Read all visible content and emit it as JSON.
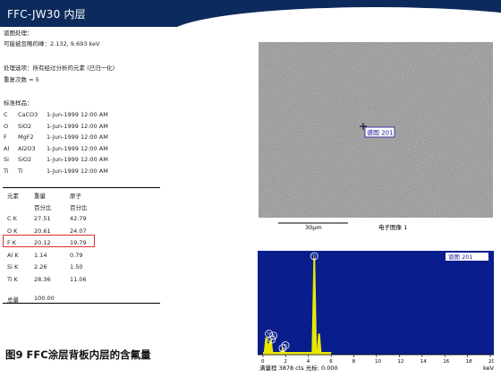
{
  "header": {
    "title": "FFC-JW30 内层"
  },
  "processing": {
    "label": "谱图处理：",
    "omitted_peaks": "可能被忽略的峰：2.132, 9.693 keV",
    "options": "处理选项：所有经过分析的元素 (已归一化)",
    "iterations": "重复次数 = 5"
  },
  "standards": {
    "label": "标准样品：",
    "rows": [
      {
        "el": "C",
        "std": "CaCO3",
        "date": "1-Jun-1999 12:00 AM"
      },
      {
        "el": "O",
        "std": "SiO2",
        "date": "1-Jun-1999 12:00 AM"
      },
      {
        "el": "F",
        "std": "MgF2",
        "date": "1-Jun-1999 12:00 AM"
      },
      {
        "el": "Al",
        "std": "Al2O3",
        "date": "1-Jun-1999 12:00 AM"
      },
      {
        "el": "Si",
        "std": "SiO2",
        "date": "1-Jun-1999 12:00 AM"
      },
      {
        "el": "Ti",
        "std": "Ti",
        "date": "1-Jun-1999 12:00 AM"
      }
    ]
  },
  "results": {
    "head_element": "元素",
    "head_weight": "重量",
    "head_weight_unit": "百分比",
    "head_atomic": "原子",
    "head_atomic_unit": "百分比",
    "rows": [
      {
        "el": "C K",
        "wt": "27.51",
        "at": "42.79"
      },
      {
        "el": "O K",
        "wt": "20.61",
        "at": "24.07"
      },
      {
        "el": "F K",
        "wt": "20.12",
        "at": "19.79"
      },
      {
        "el": "Al K",
        "wt": "1.14",
        "at": "0.79"
      },
      {
        "el": "Si K",
        "wt": "2.26",
        "at": "1.50"
      },
      {
        "el": "Ti K",
        "wt": "28.36",
        "at": "11.06"
      }
    ],
    "total_label": "总量",
    "total_value": "100.00"
  },
  "caption": "图9 FFC涂层背板内层的含氟量",
  "sem": {
    "spectrum_marker": "谱图 201",
    "scale_bar": "30μm",
    "image_label": "电子图像 1"
  },
  "colors": {
    "banner": "#0d2a5c",
    "highlight": "#e03030",
    "spectrum_bg": "#0a1d8c",
    "peaks": "#e8e800"
  },
  "chart_data": {
    "type": "line",
    "title": "谱图 201",
    "xlabel": "keV",
    "xlim": [
      0,
      20
    ],
    "x_ticks": [
      "0",
      "2",
      "4",
      "6",
      "8",
      "10",
      "12",
      "14",
      "16",
      "18",
      "20"
    ],
    "peak_labels": [
      "Ti",
      "Ti",
      "Ti",
      "Ti",
      "Ti",
      "Ti"
    ],
    "footer": "满量程 3878 cts 光标: 0.000",
    "series": [
      {
        "values": [
          [
            0.28,
            18
          ],
          [
            0.53,
            12
          ],
          [
            0.68,
            16
          ],
          [
            0.45,
            6
          ],
          [
            1.49,
            3
          ],
          [
            1.74,
            6
          ],
          [
            4.51,
            100
          ],
          [
            4.93,
            22
          ]
        ]
      }
    ]
  }
}
